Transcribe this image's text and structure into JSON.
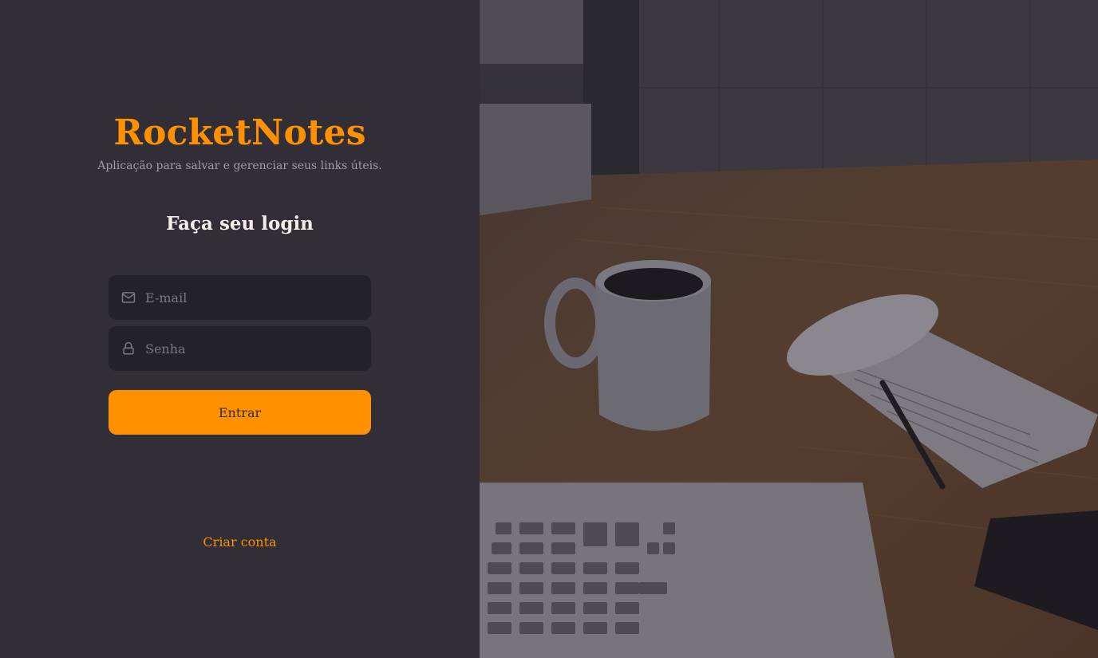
{
  "brand": {
    "title": "RocketNotes",
    "subtitle": "Aplicação para salvar e gerenciar seus links úteis."
  },
  "login": {
    "heading": "Faça seu login",
    "email_placeholder": "E-mail",
    "password_placeholder": "Senha",
    "submit_label": "Entrar",
    "create_account_label": "Criar conta"
  },
  "colors": {
    "accent": "#ff9000",
    "panel_background": "#312e38",
    "input_background": "#232129",
    "heading_text": "#f4ede8",
    "muted_text": "#7c7783"
  },
  "icons": {
    "email": "mail-icon",
    "password": "lock-icon"
  }
}
